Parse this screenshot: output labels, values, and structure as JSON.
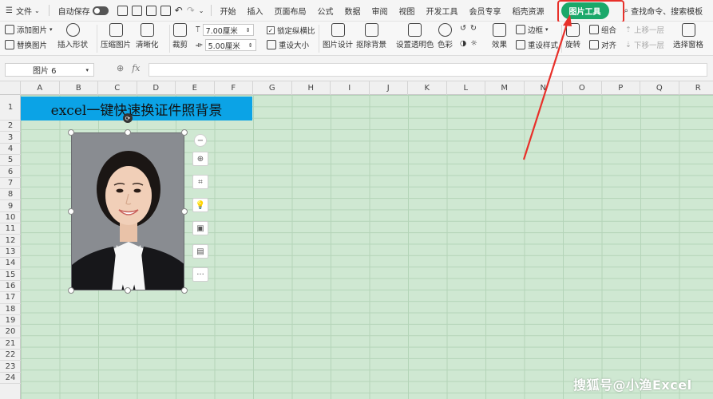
{
  "menubar": {
    "file": "文件",
    "autosave": "自动保存",
    "tabs": [
      "开始",
      "插入",
      "页面布局",
      "公式",
      "数据",
      "审阅",
      "视图",
      "开发工具",
      "会员专享",
      "稻壳资源"
    ],
    "active_tab": "图片工具",
    "search": "查找命令、搜索模板"
  },
  "ribbon": {
    "add_picture": "添加图片",
    "replace_picture": "替换图片",
    "insert_shape": "插入形状",
    "compress": "压缩图片",
    "clarity": "清晰化",
    "crop": "裁剪",
    "height": "7.00厘米",
    "width": "5.00厘米",
    "lock_ratio": "锁定纵横比",
    "reset_size": "重设大小",
    "picture_design": "图片设计",
    "remove_bg": "抠除背景",
    "set_transparent": "设置透明色",
    "color": "色彩",
    "effects": "效果",
    "border": "边框",
    "reset_style": "重设样式",
    "group": "组合",
    "rotate": "旋转",
    "align": "对齐",
    "move_up": "上移一层",
    "move_down": "下移一层",
    "selection_pane": "选择窗格"
  },
  "formula_bar": {
    "name_box": "图片 6",
    "fx": "fx"
  },
  "sheet": {
    "columns": [
      "A",
      "B",
      "C",
      "D",
      "E",
      "F",
      "G",
      "H",
      "I",
      "J",
      "K",
      "L",
      "M",
      "N",
      "O",
      "P",
      "Q",
      "R"
    ],
    "rows": [
      "1",
      "2",
      "3",
      "4",
      "5",
      "6",
      "7",
      "8",
      "9",
      "10",
      "11",
      "12",
      "13",
      "14",
      "15",
      "16",
      "17",
      "18",
      "19",
      "20",
      "21",
      "22",
      "23",
      "24"
    ],
    "title": "excel一键快速换证件照背景"
  },
  "photo_tools": [
    "−",
    "⊕",
    "⌗",
    "💡",
    "▣",
    "▤",
    "···"
  ],
  "watermark": "搜狐号@小渔Excel",
  "colors": {
    "sheet_bg": "#cfe8d2",
    "title_fill": "#0ba3e6",
    "active_tab": "#1aa86a",
    "highlight": "#e8302a"
  }
}
